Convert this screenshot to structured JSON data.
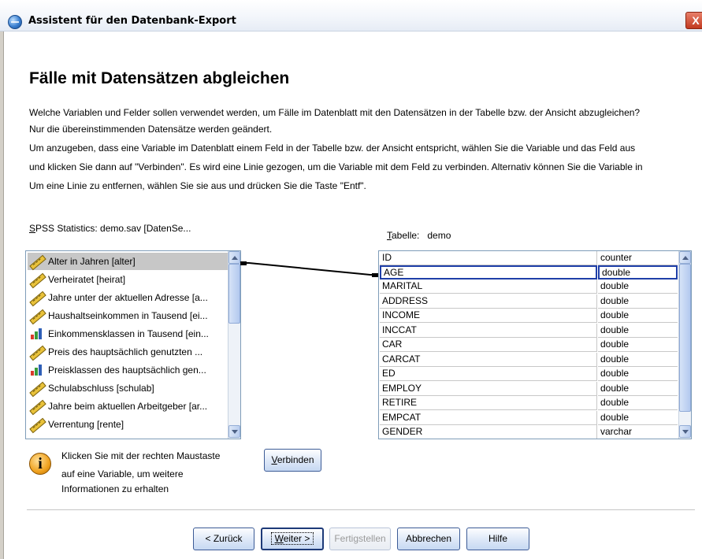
{
  "window": {
    "title": "Assistent für den Datenbank-Export",
    "close_glyph": "X"
  },
  "page": {
    "heading": "Fälle mit Datensätzen abgleichen",
    "paragraphs": [
      "Welche Variablen und Felder sollen verwendet werden, um Fälle im Datenblatt mit den Datensätzen in der Tabelle bzw. der Ansicht abzugleichen?",
      "Nur die übereinstimmenden Datensätze werden geändert.",
      "Um anzugeben, dass eine Variable im Datenblatt einem Feld in der Tabelle bzw. der Ansicht entspricht, wählen Sie die Variable und das Feld aus",
      "und klicken Sie dann auf \"Verbinden\". Es wird eine Linie gezogen, um die Variable mit dem Feld zu verbinden. Alternativ können Sie die Variable in",
      "Um eine Linie zu entfernen, wählen Sie sie aus und drücken Sie die Taste \"Entf\"."
    ]
  },
  "source": {
    "label_prefix": "S",
    "label_rest": "PSS Statistics:  demo.sav [DatenSe...",
    "items": [
      {
        "label": "Alter in Jahren [alter]",
        "icon": "scale-ruler-icon",
        "selected": true
      },
      {
        "label": "Verheiratet [heirat]",
        "icon": "scale-ruler-icon"
      },
      {
        "label": "Jahre unter der aktuellen Adresse [a...",
        "icon": "scale-ruler-icon"
      },
      {
        "label": "Haushaltseinkommen in Tausend [ei...",
        "icon": "scale-ruler-icon"
      },
      {
        "label": "Einkommensklassen in Tausend [ein...",
        "icon": "ordinal-bar-icon"
      },
      {
        "label": "Preis des hauptsächlich genutzten ...",
        "icon": "scale-ruler-icon"
      },
      {
        "label": "Preisklassen des hauptsächlich gen...",
        "icon": "ordinal-bar-icon"
      },
      {
        "label": "Schulabschluss [schulab]",
        "icon": "scale-ruler-icon"
      },
      {
        "label": "Jahre beim aktuellen Arbeitgeber [ar...",
        "icon": "scale-ruler-icon"
      },
      {
        "label": "Verrentung [rente]",
        "icon": "scale-ruler-icon"
      }
    ]
  },
  "table": {
    "label_prefix": "T",
    "label_rest": "abelle:",
    "name": "demo",
    "rows": [
      {
        "field": "ID",
        "type": "counter"
      },
      {
        "field": "AGE",
        "type": "double",
        "selected": true
      },
      {
        "field": "MARITAL",
        "type": "double"
      },
      {
        "field": "ADDRESS",
        "type": "double"
      },
      {
        "field": "INCOME",
        "type": "double"
      },
      {
        "field": "INCCAT",
        "type": "double"
      },
      {
        "field": "CAR",
        "type": "double"
      },
      {
        "field": "CARCAT",
        "type": "double"
      },
      {
        "field": "ED",
        "type": "double"
      },
      {
        "field": "EMPLOY",
        "type": "double"
      },
      {
        "field": "RETIRE",
        "type": "double"
      },
      {
        "field": "EMPCAT",
        "type": "double"
      },
      {
        "field": "GENDER",
        "type": "varchar"
      }
    ]
  },
  "info": {
    "icon": "information-icon",
    "lines": [
      "Klicken Sie mit der rechten Maustaste",
      "auf eine Variable, um weitere",
      "Informationen zu erhalten"
    ]
  },
  "buttons": {
    "connect_prefix": "V",
    "connect_rest": "erbinden",
    "back": "< Zurück",
    "next_prefix": "W",
    "next_rest": "eiter >",
    "finish": "Fertigstellen",
    "cancel": "Abbrechen",
    "help": "Hilfe"
  },
  "colors": {
    "selection_gray": "#c7c7c7",
    "selection_border": "#1f3fa8",
    "button_border": "#3c5b96"
  }
}
